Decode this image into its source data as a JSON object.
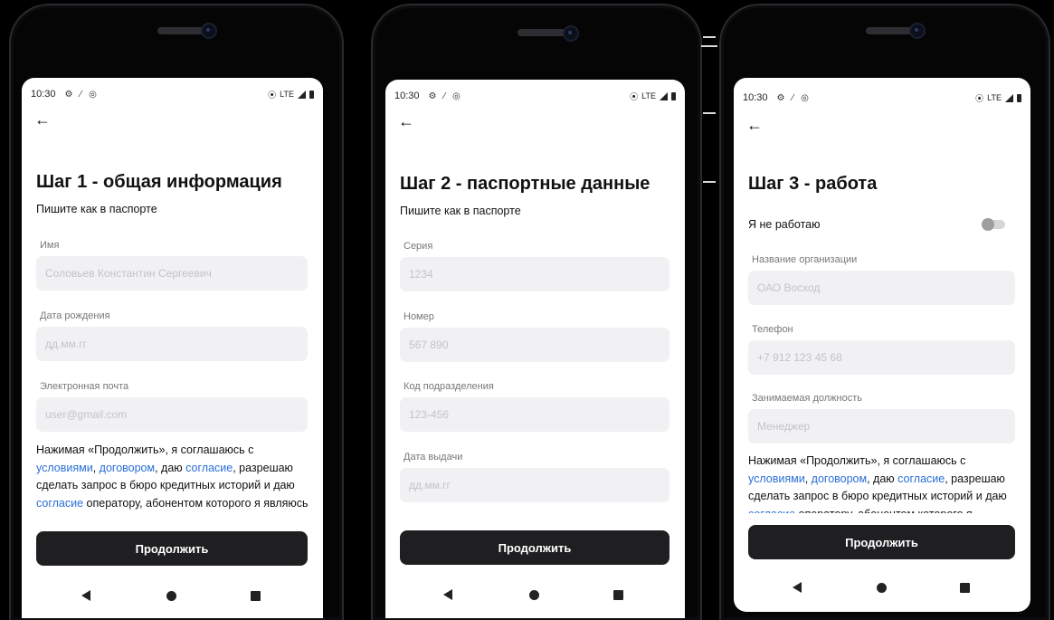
{
  "status": {
    "time": "10:30",
    "network": "LTE"
  },
  "cta_label": "Продолжить",
  "consent": {
    "p1": "Нажимая «Продолжить», я соглашаюсь с ",
    "l1": "условиями",
    "p2": ", ",
    "l2": "договором",
    "p3": ", даю ",
    "l3": "согласие",
    "p4": ", разрешаю сделать запрос в бюро кредитных историй и даю ",
    "l4": "согласие",
    "p5": " оператору, абонентом которого я являюсь"
  },
  "screens": [
    {
      "title": "Шаг 1 - общая информация",
      "subtitle": "Пишите как в паспорте",
      "fields": [
        {
          "label": "Имя",
          "placeholder": "Соловьев Константин Сергеевич"
        },
        {
          "label": "Дата рождения",
          "placeholder": "дд.мм.гг"
        },
        {
          "label": "Электронная почта",
          "placeholder": "user@gmail.com"
        }
      ]
    },
    {
      "title": "Шаг 2 - паспортные данные",
      "subtitle": "Пишите как в паспорте",
      "fields": [
        {
          "label": "Серия",
          "placeholder": "1234"
        },
        {
          "label": "Номер",
          "placeholder": "567 890"
        },
        {
          "label": "Код подразделения",
          "placeholder": "123-456"
        },
        {
          "label": "Дата выдачи",
          "placeholder": "дд.мм.гг"
        }
      ]
    },
    {
      "title": "Шаг 3 - работа",
      "toggle_label": "Я не работаю",
      "toggle_on": false,
      "fields": [
        {
          "label": "Название организации",
          "placeholder": "ОАО Восход"
        },
        {
          "label": "Телефон",
          "placeholder": "+7 912 123 45 68"
        },
        {
          "label": "Занимаемая должность",
          "placeholder": "Менеджер"
        }
      ]
    }
  ]
}
